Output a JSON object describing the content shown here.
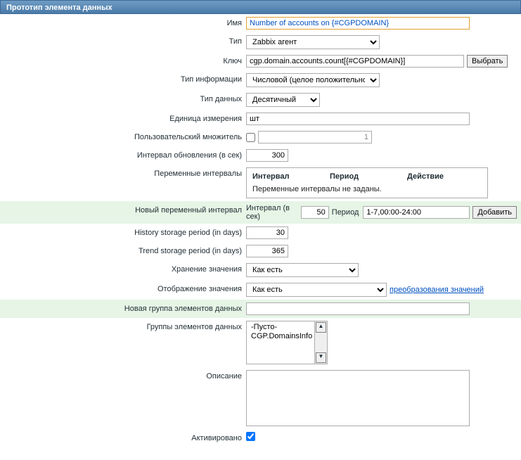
{
  "header": {
    "title": "Прототип элемента данных"
  },
  "labels": {
    "name": "Имя",
    "type": "Тип",
    "key": "Ключ",
    "info_type": "Тип информации",
    "data_type": "Тип данных",
    "unit": "Единица измерения",
    "multiplier": "Пользовательский множитель",
    "update_interval": "Интервал обновления (в сек)",
    "flex_intervals": "Переменные интервалы",
    "new_flex": "Новый переменный интервал",
    "history": "History storage period (in days)",
    "trends": "Trend storage period (in days)",
    "store_value": "Хранение значения",
    "show_value": "Отображение значения",
    "new_group": "Новая группа элементов данных",
    "groups": "Группы элементов данных",
    "description": "Описание",
    "enabled": "Активировано",
    "flex_col_interval": "Интервал",
    "flex_col_period": "Период",
    "flex_col_action": "Действие",
    "flex_interval_sec": "Интервал (в сек)",
    "flex_period": "Период",
    "flex_empty": "Переменные интервалы не заданы."
  },
  "buttons": {
    "select_key": "Выбрать",
    "add_flex": "Добавить"
  },
  "links": {
    "value_maps": "преобразования значений"
  },
  "values": {
    "name": "Number of accounts on {#CGPDOMAIN}",
    "type": "Zabbix агент",
    "key": "cgp.domain.accounts.count[{#CGPDOMAIN}]",
    "info_type": "Числовой (целое положительное)",
    "data_type": "Десятичный",
    "unit": "шт",
    "multiplier_checked": false,
    "multiplier": "1",
    "update_interval": "300",
    "flex_interval": "50",
    "flex_period": "1-7,00:00-24:00",
    "history": "30",
    "trends": "365",
    "store_value": "Как есть",
    "show_value": "Как есть",
    "new_group": "",
    "groups": [
      "-Пусто-",
      "CGP.DomainsInfo"
    ],
    "description": "",
    "enabled": true
  }
}
